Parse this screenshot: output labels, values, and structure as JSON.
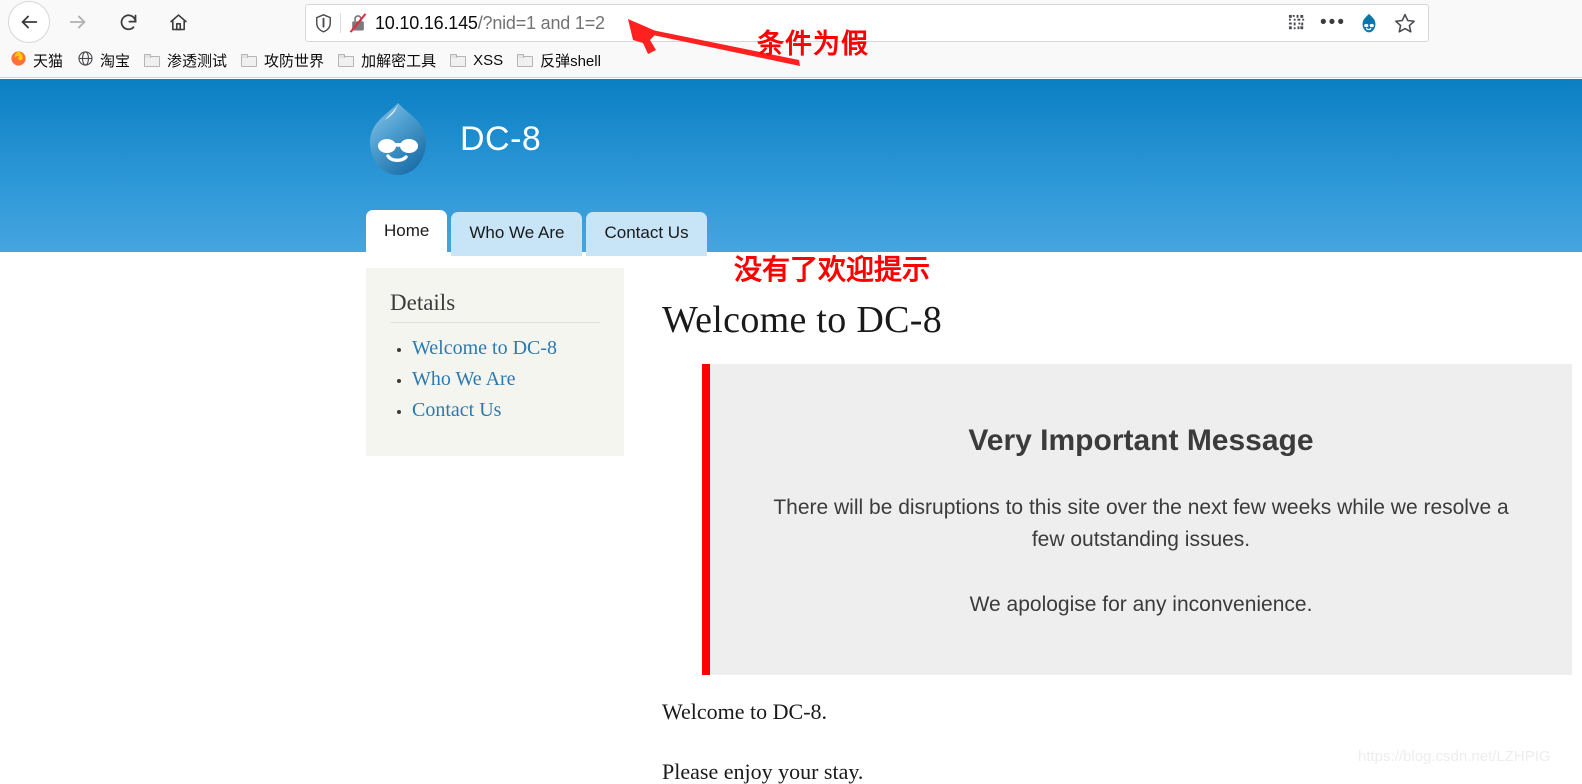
{
  "browser": {
    "nav": {
      "back": "back-arrow",
      "forward": "forward-arrow",
      "reload": "reload",
      "home": "home"
    },
    "url": {
      "host": "10.10.16.145",
      "path": "/?nid=1 and 1=2",
      "full": "10.10.16.145/?nid=1 and 1=2",
      "shield_icon": "tracking-protection-shield",
      "lock_icon": "insecure-lock-crossed"
    },
    "url_actions": [
      {
        "name": "qr-code-icon",
        "glyph": "qr"
      },
      {
        "name": "more-actions-icon",
        "glyph": "..."
      },
      {
        "name": "drupal-page-action-icon",
        "glyph": "droplet"
      },
      {
        "name": "bookmark-star-icon",
        "glyph": "star"
      }
    ],
    "bookmarks": [
      {
        "label": "天猫",
        "icon": "firefox-icon"
      },
      {
        "label": "淘宝",
        "icon": "globe-icon"
      },
      {
        "label": "渗透测试",
        "icon": "folder-icon"
      },
      {
        "label": "攻防世界",
        "icon": "folder-icon"
      },
      {
        "label": "加解密工具",
        "icon": "folder-icon"
      },
      {
        "label": "XSS",
        "icon": "folder-icon"
      },
      {
        "label": "反弹shell",
        "icon": "folder-icon"
      }
    ]
  },
  "site": {
    "name": "DC-8",
    "logo_icon": "drupal-droplet-logo",
    "tabs": [
      {
        "label": "Home",
        "active": true
      },
      {
        "label": "Who We Are",
        "active": false
      },
      {
        "label": "Contact Us",
        "active": false
      }
    ]
  },
  "sidebar": {
    "title": "Details",
    "links": [
      {
        "label": "Welcome to DC-8"
      },
      {
        "label": "Who We Are"
      },
      {
        "label": "Contact Us"
      }
    ]
  },
  "main": {
    "page_title": "Welcome to DC-8",
    "quote": {
      "heading": "Very Important Message",
      "paragraph_1": "There will be disruptions to this site over the next few weeks while we resolve a few outstanding issues.",
      "paragraph_2": "We apologise for any inconvenience."
    },
    "outro_1": "Welcome to DC-8.",
    "outro_2": "Please enjoy your stay."
  },
  "annotations": {
    "url_note": "条件为假",
    "content_note": "没有了欢迎提示",
    "arrow_icon": "red-arrow-pointing-to-url",
    "color": "#fd0000"
  },
  "watermark": "https://blog.csdn.net/LZHPIG"
}
